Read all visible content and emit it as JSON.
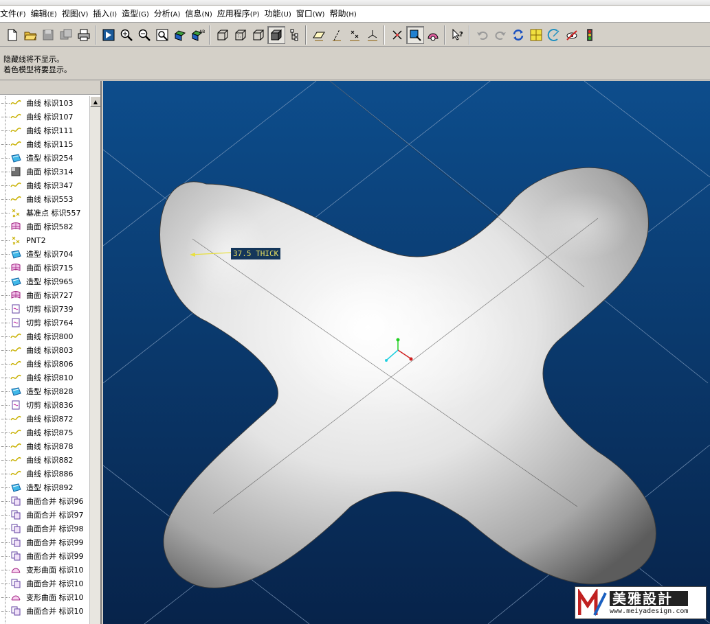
{
  "menu": [
    {
      "label": "文件",
      "key": "(F)"
    },
    {
      "label": "编辑",
      "key": "(E)"
    },
    {
      "label": "视图",
      "key": "(V)"
    },
    {
      "label": "插入",
      "key": "(I)"
    },
    {
      "label": "造型",
      "key": "(G)"
    },
    {
      "label": "分析",
      "key": "(A)"
    },
    {
      "label": "信息",
      "key": "(N)"
    },
    {
      "label": "应用程序",
      "key": "(P)"
    },
    {
      "label": "功能",
      "key": "(U)"
    },
    {
      "label": "窗口",
      "key": "(W)"
    },
    {
      "label": "帮助",
      "key": "(H)"
    }
  ],
  "messages": [
    "隐藏线将不显示。",
    "着色模型将要显示。"
  ],
  "tree": {
    "items": [
      {
        "label": "曲线 标识103",
        "icon": "curve-icon"
      },
      {
        "label": "曲线 标识107",
        "icon": "curve-icon"
      },
      {
        "label": "曲线 标识111",
        "icon": "curve-icon"
      },
      {
        "label": "曲线 标识115",
        "icon": "curve-icon"
      },
      {
        "label": "造型 标识254",
        "icon": "style-icon"
      },
      {
        "label": "曲面 标识314",
        "icon": "surface-dark-icon"
      },
      {
        "label": "曲线 标识347",
        "icon": "curve-icon"
      },
      {
        "label": "曲线 标识553",
        "icon": "curve-icon"
      },
      {
        "label": "基准点 标识557",
        "icon": "datum-point-icon"
      },
      {
        "label": "曲面 标识582",
        "icon": "surface-icon"
      },
      {
        "label": "PNT2",
        "icon": "datum-point-icon"
      },
      {
        "label": "造型 标识704",
        "icon": "style-icon"
      },
      {
        "label": "曲面 标识715",
        "icon": "surface-icon"
      },
      {
        "label": "造型 标识965",
        "icon": "style-icon"
      },
      {
        "label": "曲面 标识727",
        "icon": "surface-icon"
      },
      {
        "label": "切剪 标识739",
        "icon": "trim-icon"
      },
      {
        "label": "切剪 标识764",
        "icon": "trim-icon"
      },
      {
        "label": "曲线 标识800",
        "icon": "curve-icon"
      },
      {
        "label": "曲线 标识803",
        "icon": "curve-icon"
      },
      {
        "label": "曲线 标识806",
        "icon": "curve-icon"
      },
      {
        "label": "曲线 标识810",
        "icon": "curve-icon"
      },
      {
        "label": "造型 标识828",
        "icon": "style-icon"
      },
      {
        "label": "切剪 标识836",
        "icon": "trim-icon"
      },
      {
        "label": "曲线 标识872",
        "icon": "curve-icon"
      },
      {
        "label": "曲线 标识875",
        "icon": "curve-icon"
      },
      {
        "label": "曲线 标识878",
        "icon": "curve-icon"
      },
      {
        "label": "曲线 标识882",
        "icon": "curve-icon"
      },
      {
        "label": "曲线 标识886",
        "icon": "curve-icon"
      },
      {
        "label": "造型 标识892",
        "icon": "style-icon"
      },
      {
        "label": "曲面合并 标识96",
        "icon": "merge-icon"
      },
      {
        "label": "曲面合并 标识97",
        "icon": "merge-icon"
      },
      {
        "label": "曲面合并 标识98",
        "icon": "merge-icon"
      },
      {
        "label": "曲面合并 标识99",
        "icon": "merge-icon"
      },
      {
        "label": "曲面合并 标识99",
        "icon": "merge-icon"
      },
      {
        "label": "变形曲面 标识10",
        "icon": "warp-icon"
      },
      {
        "label": "曲面合并 标识10",
        "icon": "merge-icon"
      },
      {
        "label": "变形曲面 标识10",
        "icon": "warp-icon"
      },
      {
        "label": "曲面合并 标识10",
        "icon": "merge-icon"
      }
    ]
  },
  "viewport": {
    "annotation": "37.5 THICK",
    "background_top": "#0d4d8c",
    "background_bottom": "#07234a"
  },
  "watermark": {
    "brand": "美雅設計",
    "url": "www.meiyadesign.com"
  }
}
